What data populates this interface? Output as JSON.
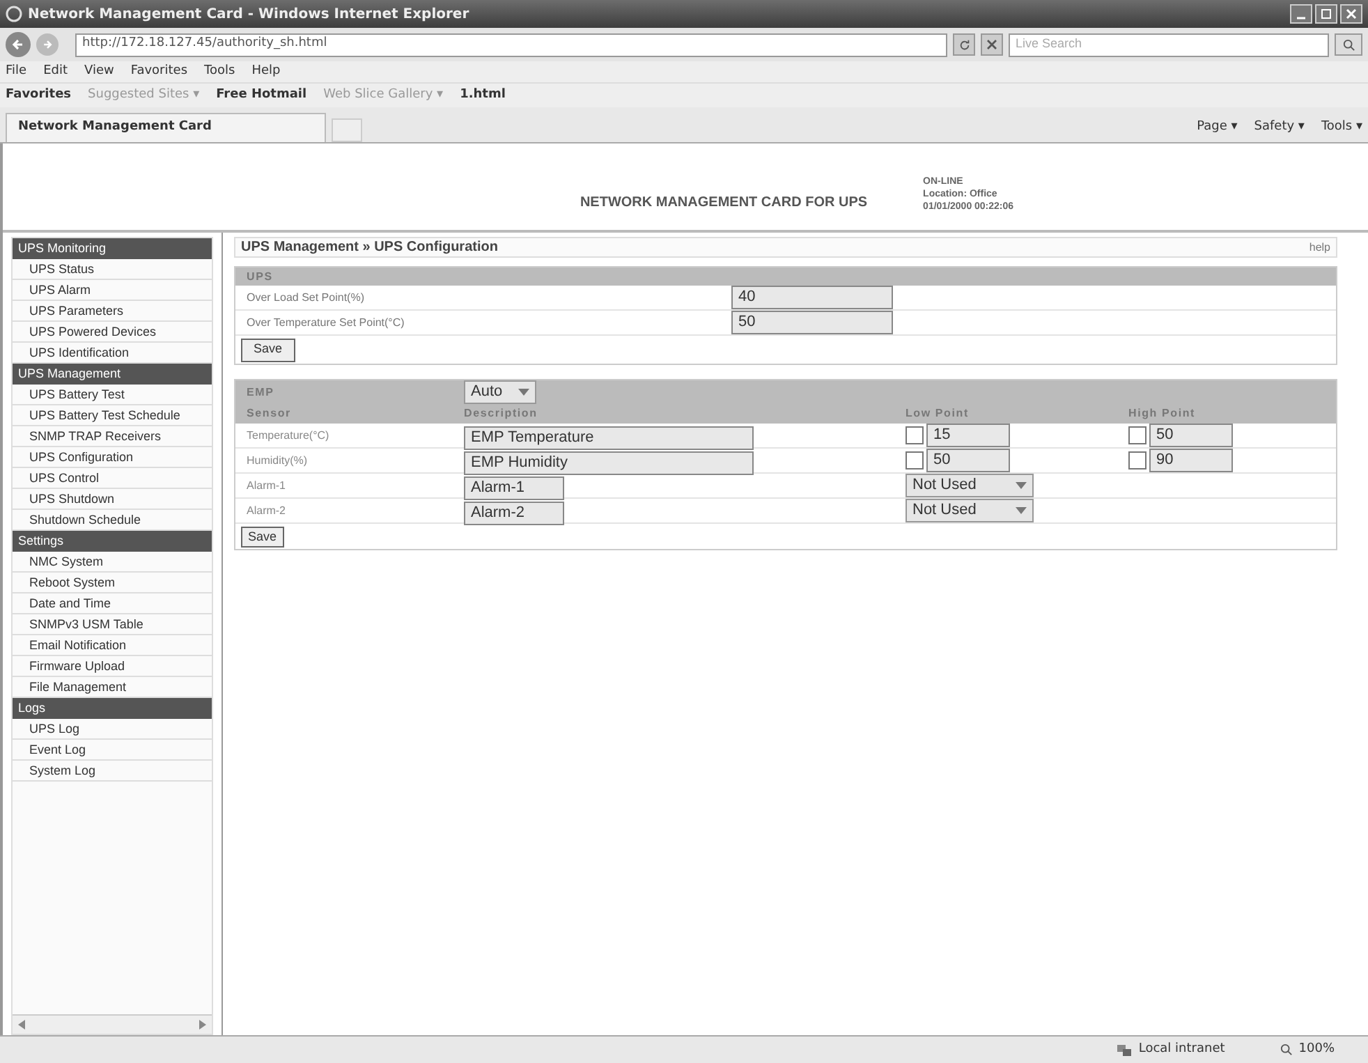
{
  "window": {
    "title": "Network Management Card - Windows Internet Explorer"
  },
  "address_bar": {
    "url": "http://172.18.127.45/authority_sh.html",
    "search_placeholder": "Live Search"
  },
  "menu": [
    "File",
    "Edit",
    "View",
    "Favorites",
    "Tools",
    "Help"
  ],
  "favorites_bar": [
    {
      "label": "Favorites"
    },
    {
      "label": "Suggested Sites ▾"
    },
    {
      "label": "Free Hotmail"
    },
    {
      "label": "Web Slice Gallery ▾"
    },
    {
      "label": "1.html"
    }
  ],
  "tab": {
    "title": "Network Management Card"
  },
  "command_bar": [
    "Page ▾",
    "Safety ▾",
    "Tools ▾"
  ],
  "header": {
    "title": "NETWORK MANAGEMENT CARD FOR UPS",
    "status": [
      "ON-LINE",
      "Location: Office",
      "01/01/2000 00:22:06"
    ]
  },
  "sidebar": [
    {
      "title": "UPS Monitoring",
      "items": [
        "UPS Status",
        "UPS Alarm",
        "UPS Parameters",
        "UPS Powered Devices",
        "UPS Identification"
      ]
    },
    {
      "title": "UPS Management",
      "items": [
        "UPS Battery Test",
        "UPS Battery Test Schedule",
        "SNMP TRAP Receivers",
        "UPS Configuration",
        "UPS Control",
        "UPS Shutdown",
        "Shutdown Schedule"
      ]
    },
    {
      "title": "Settings",
      "items": [
        "NMC System",
        "Reboot System",
        "Date and Time",
        "SNMPv3 USM Table",
        "Email Notification",
        "Firmware Upload",
        "File Management"
      ]
    },
    {
      "title": "Logs",
      "items": [
        "UPS Log",
        "Event Log",
        "System Log"
      ]
    }
  ],
  "breadcrumb": "UPS Management » UPS Configuration",
  "help": "help",
  "ups": {
    "title": "UPS",
    "rows": [
      {
        "label": "Over Load Set Point(%)",
        "value": "40"
      },
      {
        "label": "Over Temperature Set Point(°C)",
        "value": "50"
      }
    ],
    "save": "Save"
  },
  "emp": {
    "title": "EMP",
    "mode": "Auto",
    "columns": [
      "Sensor",
      "Description",
      "Low Point",
      "High Point"
    ],
    "rows": [
      {
        "kind": "threshold",
        "sensor": "Temperature(°C)",
        "description": "EMP Temperature",
        "low": {
          "checked": false,
          "value": "15"
        },
        "high": {
          "checked": false,
          "value": "50"
        }
      },
      {
        "kind": "threshold",
        "sensor": "Humidity(%)",
        "description": "EMP Humidity",
        "low": {
          "checked": false,
          "value": "50"
        },
        "high": {
          "checked": false,
          "value": "90"
        }
      },
      {
        "kind": "alarm",
        "sensor": "Alarm-1",
        "description": "Alarm-1",
        "option": "Not Used"
      },
      {
        "kind": "alarm",
        "sensor": "Alarm-2",
        "description": "Alarm-2",
        "option": "Not Used"
      }
    ],
    "save": "Save"
  },
  "status_bar": {
    "zone": "Local intranet",
    "zoom": "100%"
  }
}
